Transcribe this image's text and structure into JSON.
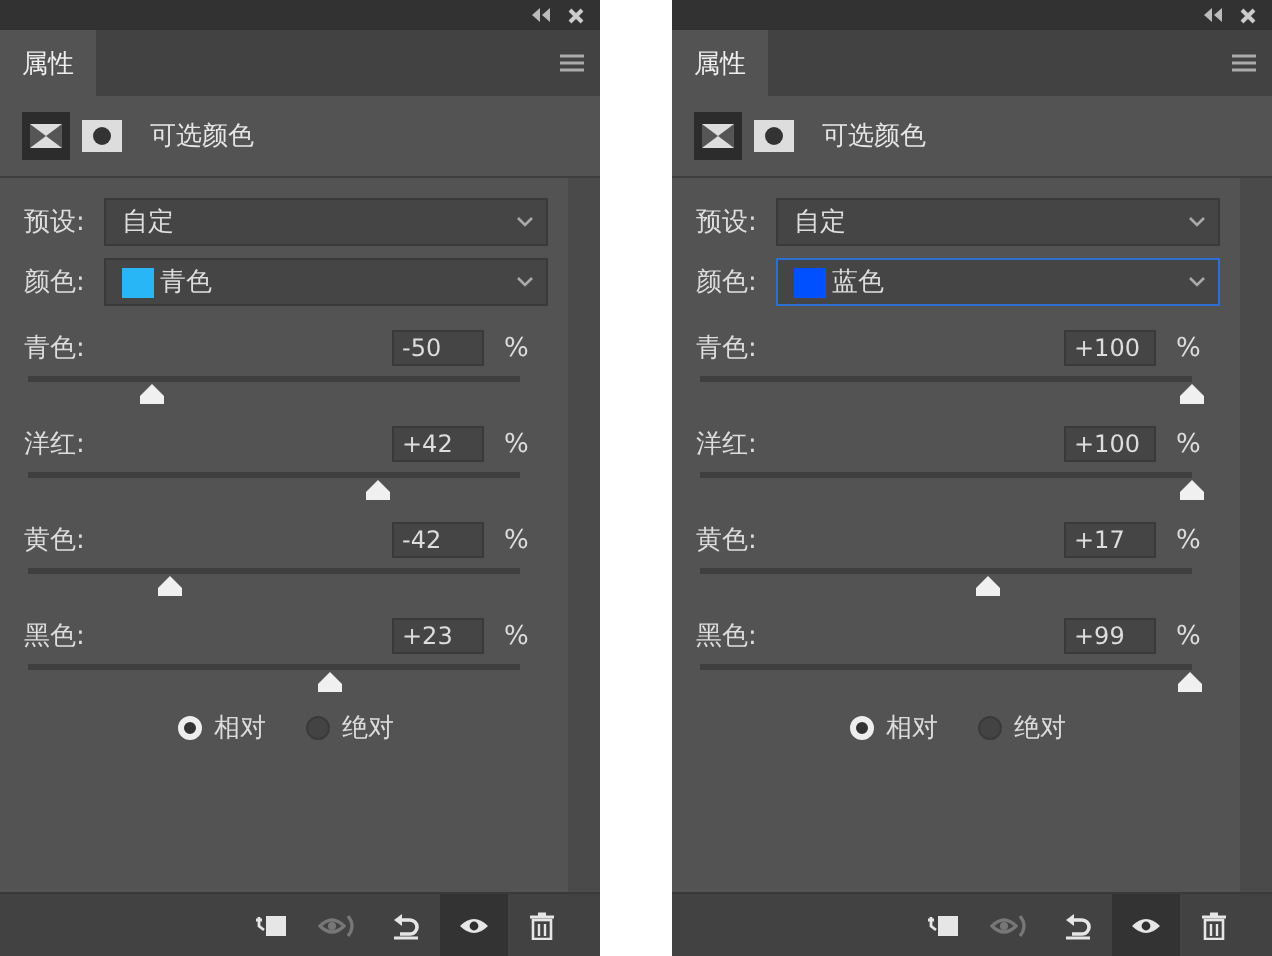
{
  "panels": [
    {
      "tab": {
        "label": "属性",
        "selected": true
      },
      "title": "可选颜色",
      "preset": {
        "label": "预设:",
        "value": "自定"
      },
      "color": {
        "label": "颜色:",
        "value": "青色",
        "color": "#29b6f6",
        "focused": false
      },
      "sliders": [
        {
          "name": "青色:",
          "value": "-50",
          "unit": "%",
          "level": 0.25
        },
        {
          "name": "洋红:",
          "value": "+42",
          "unit": "%",
          "level": 0.71
        },
        {
          "name": "黄色:",
          "value": "-42",
          "unit": "%",
          "level": 0.29
        },
        {
          "name": "黑色:",
          "value": "+23",
          "unit": "%",
          "level": 0.615
        }
      ],
      "radios": [
        {
          "label": "相对",
          "selected": true
        },
        {
          "label": "绝对",
          "selected": false
        }
      ],
      "toolbar": [
        {
          "kind": "clip",
          "selected": false,
          "disabled": false
        },
        {
          "kind": "view-previous",
          "selected": false,
          "disabled": true
        },
        {
          "kind": "reset",
          "selected": false,
          "disabled": false
        },
        {
          "kind": "visibility",
          "selected": true,
          "disabled": false
        },
        {
          "kind": "delete",
          "selected": false,
          "disabled": false
        }
      ]
    },
    {
      "tab": {
        "label": "属性",
        "selected": true
      },
      "title": "可选颜色",
      "preset": {
        "label": "预设:",
        "value": "自定"
      },
      "color": {
        "label": "颜色:",
        "value": "蓝色",
        "color": "#0050ff",
        "focused": true
      },
      "sliders": [
        {
          "name": "青色:",
          "value": "+100",
          "unit": "%",
          "level": 1
        },
        {
          "name": "洋红:",
          "value": "+100",
          "unit": "%",
          "level": 1
        },
        {
          "name": "黄色:",
          "value": "+17",
          "unit": "%",
          "level": 0.585
        },
        {
          "name": "黑色:",
          "value": "+99",
          "unit": "%",
          "level": 0.995
        }
      ],
      "radios": [
        {
          "label": "相对",
          "selected": true
        },
        {
          "label": "绝对",
          "selected": false
        }
      ],
      "toolbar": [
        {
          "kind": "clip",
          "selected": false,
          "disabled": false
        },
        {
          "kind": "view-previous",
          "selected": false,
          "disabled": true
        },
        {
          "kind": "reset",
          "selected": false,
          "disabled": false
        },
        {
          "kind": "visibility",
          "selected": true,
          "disabled": false
        },
        {
          "kind": "delete",
          "selected": false,
          "disabled": false
        }
      ]
    }
  ]
}
